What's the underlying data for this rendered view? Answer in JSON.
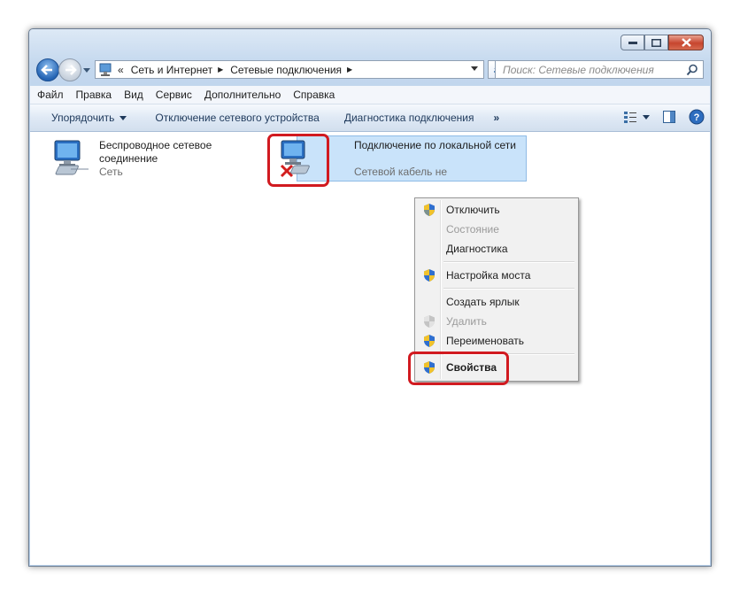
{
  "address": {
    "crumbs": [
      "Сеть и Интернет",
      "Сетевые подключения"
    ],
    "overflow_glyph": "«"
  },
  "search": {
    "placeholder": "Поиск: Сетевые подключения"
  },
  "menu": {
    "items": [
      "Файл",
      "Правка",
      "Вид",
      "Сервис",
      "Дополнительно",
      "Справка"
    ]
  },
  "toolbar": {
    "organize": "Упорядочить",
    "disable_device": "Отключение сетевого устройства",
    "diagnose": "Диагностика подключения",
    "more": "»"
  },
  "connections": [
    {
      "name_line1": "Беспроводное сетевое",
      "name_line2": "соединение",
      "status": "Сеть",
      "icon": "wireless-network-icon"
    },
    {
      "name_line1": "Подключение по локальной сети",
      "status": "Сетевой кабель не",
      "icon": "lan-disconnected-icon"
    }
  ],
  "context_menu": {
    "items": [
      {
        "label": "Отключить",
        "shield": true,
        "disabled": false
      },
      {
        "label": "Состояние",
        "shield": false,
        "disabled": true
      },
      {
        "label": "Диагностика",
        "shield": false,
        "disabled": false
      },
      {
        "label": "Настройка моста",
        "shield": true,
        "disabled": false
      },
      {
        "label": "Создать ярлык",
        "shield": false,
        "disabled": false
      },
      {
        "label": "Удалить",
        "shield": true,
        "disabled": true
      },
      {
        "label": "Переименовать",
        "shield": true,
        "disabled": false
      },
      {
        "label": "Свойства",
        "shield": true,
        "disabled": false,
        "bold": true
      }
    ]
  },
  "colors": {
    "highlight": "#d11a20",
    "selection": "#c9e3fa",
    "toolbar_text": "#1e395b"
  }
}
